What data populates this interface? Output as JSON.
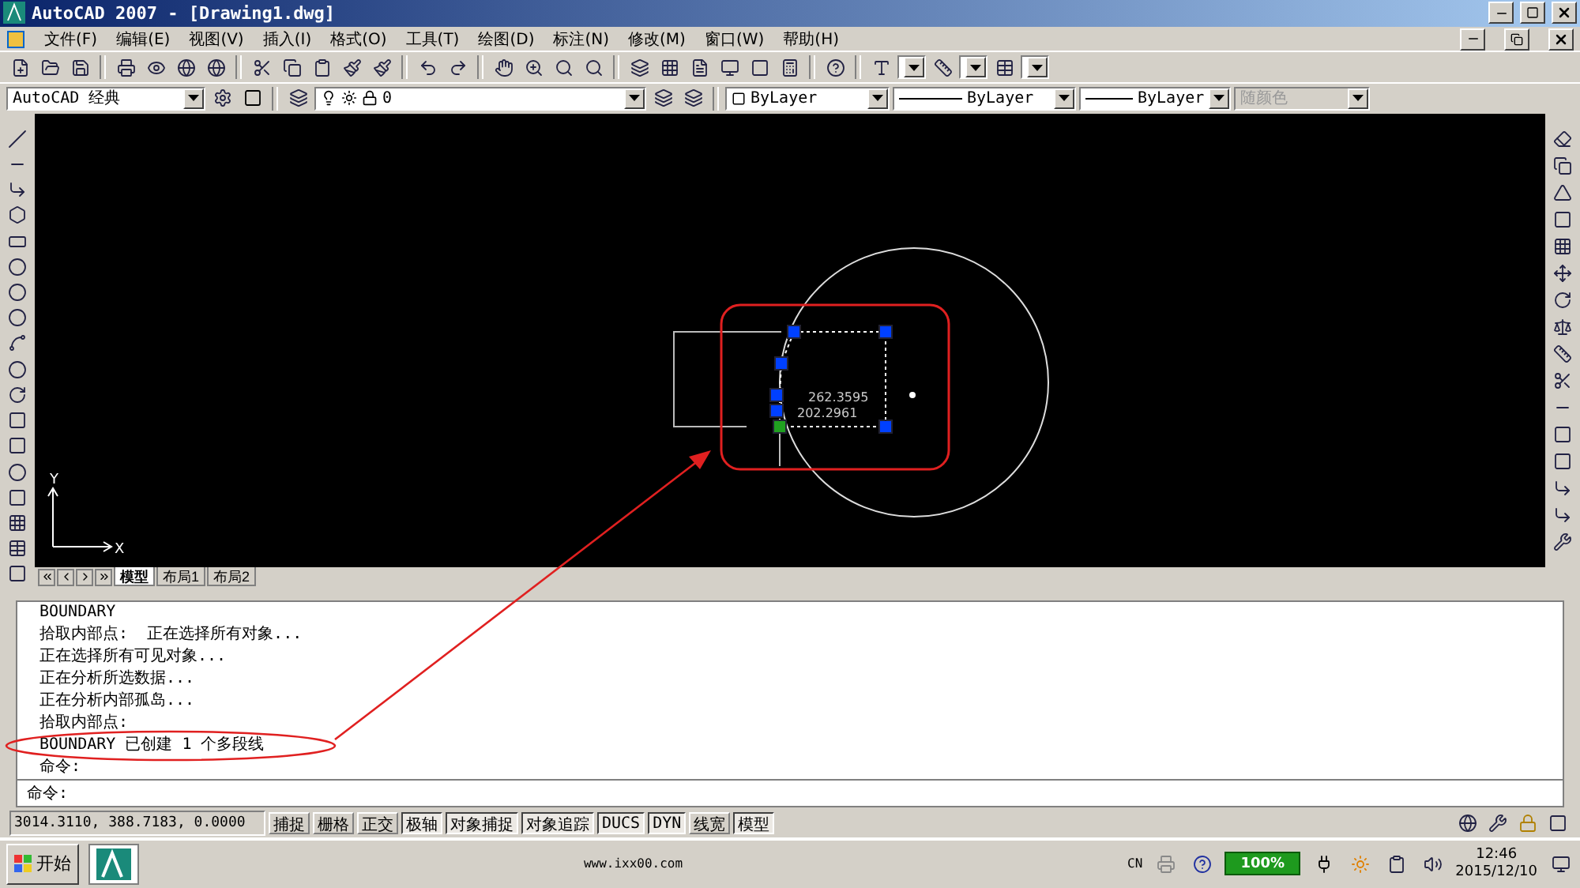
{
  "window": {
    "title": "AutoCAD 2007 - [Drawing1.dwg]"
  },
  "menu": [
    "文件(F)",
    "编辑(E)",
    "视图(V)",
    "插入(I)",
    "格式(O)",
    "工具(T)",
    "绘图(D)",
    "标注(N)",
    "修改(M)",
    "窗口(W)",
    "帮助(H)"
  ],
  "toolbar_combos": {
    "workspace": "AutoCAD 经典",
    "layer": "0",
    "color_control": "ByLayer",
    "linetype": "ByLayer",
    "lineweight": "ByLayer",
    "plot_style": {
      "value": "随颜色",
      "disabled": true
    }
  },
  "canvas": {
    "dimension_readings": [
      "262.3595",
      "202.2961"
    ],
    "ucs_axes": [
      "Y",
      "X"
    ]
  },
  "layout_tabs": [
    {
      "label": "模型",
      "selected": true
    },
    {
      "label": "布局1",
      "selected": false
    },
    {
      "label": "布局2",
      "selected": false
    }
  ],
  "command_history": [
    "BOUNDARY",
    "拾取内部点:  正在选择所有对象...",
    "正在选择所有可见对象...",
    "正在分析所选数据...",
    "正在分析内部孤岛...",
    "拾取内部点:",
    "BOUNDARY 已创建 1 个多段线",
    "命令:"
  ],
  "command_prompt": "命令:",
  "status_bar": {
    "coordinates": "3014.3110, 388.7183, 0.0000",
    "toggles": [
      {
        "label": "捕捉",
        "on": false
      },
      {
        "label": "栅格",
        "on": false
      },
      {
        "label": "正交",
        "on": false
      },
      {
        "label": "极轴",
        "on": true
      },
      {
        "label": "对象捕捉",
        "on": true
      },
      {
        "label": "对象追踪",
        "on": true
      },
      {
        "label": "DUCS",
        "on": true
      },
      {
        "label": "DYN",
        "on": true
      },
      {
        "label": "线宽",
        "on": false
      },
      {
        "label": "模型",
        "on": true
      }
    ]
  },
  "taskbar": {
    "start": "开始",
    "center_text": "www.ixx00.com",
    "language": "CN",
    "battery": "100%",
    "time": "12:46",
    "date": "2015/12/10"
  }
}
